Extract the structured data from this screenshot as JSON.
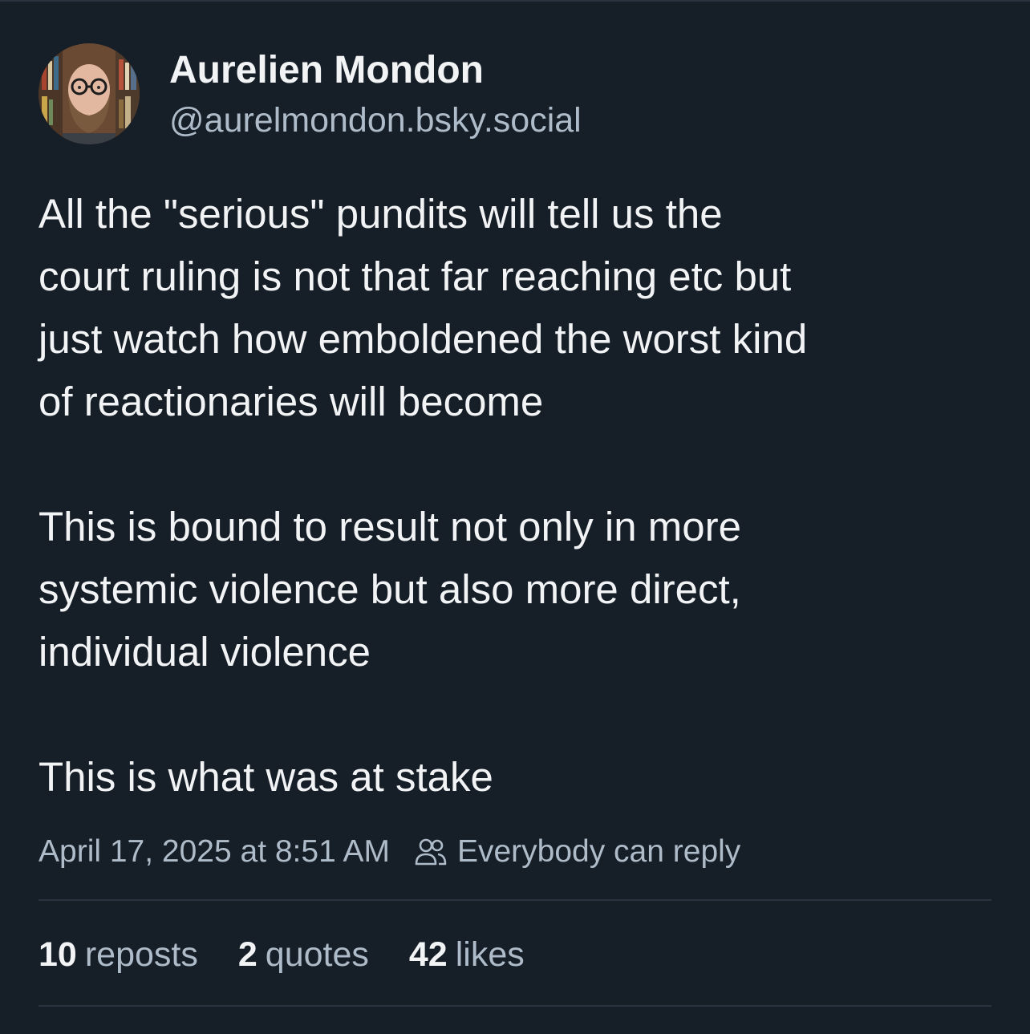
{
  "author": {
    "display_name": "Aurelien Mondon",
    "handle": "@aurelmondon.bsky.social",
    "avatar": "bearded-man-with-glasses-photo"
  },
  "post": {
    "lines": [
      "All the \"serious\" pundits will tell us the",
      "court ruling is not that far reaching etc but",
      "just watch how emboldened the worst kind",
      "of reactionaries will become",
      "This is bound to result not only in more",
      "systemic violence but also more direct,",
      "individual violence",
      "This is what was at stake"
    ],
    "timestamp": "April 17, 2025 at 8:51 AM",
    "reply_setting": "Everybody can reply",
    "reply_setting_icon": "people-icon"
  },
  "stats": {
    "reposts_count": "10",
    "reposts_label": "reposts",
    "quotes_count": "2",
    "quotes_label": "quotes",
    "likes_count": "42",
    "likes_label": "likes"
  },
  "colors": {
    "background": "#161e27",
    "primary_text": "#f1f3f5",
    "secondary_text": "#aebbc9",
    "divider": "#2a3440"
  }
}
